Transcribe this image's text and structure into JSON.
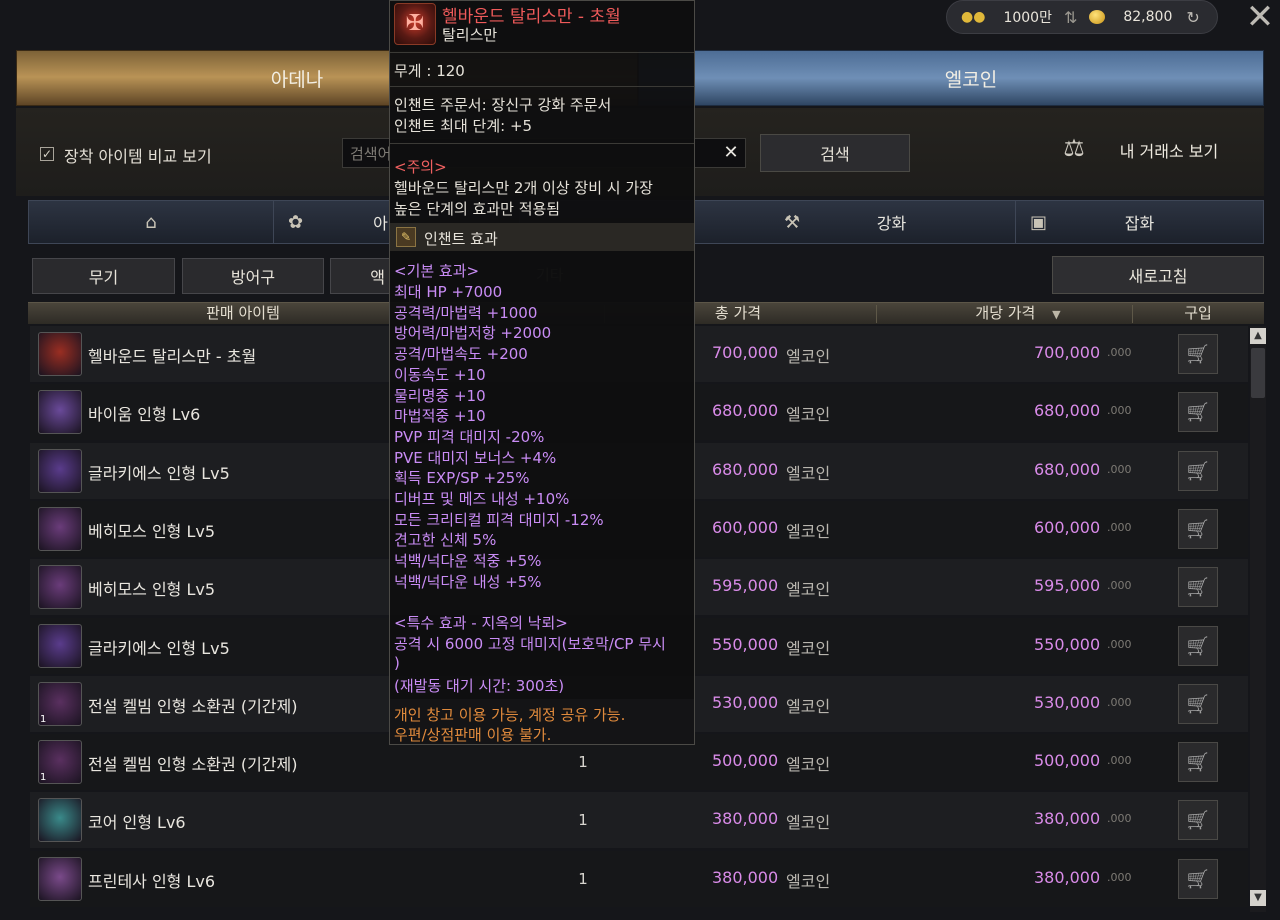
{
  "header": {
    "adena_amount": "1000만",
    "ecoin_amount": "82,800",
    "close_icon": "close-icon",
    "tabs": [
      {
        "label": "아데나"
      },
      {
        "label": "엘코인"
      }
    ]
  },
  "search": {
    "compare_label": "장착 아이템 비교 보기",
    "compare_checked": true,
    "placeholder": "검색어",
    "search_button": "검색",
    "my_exchange": "내 거래소 보기"
  },
  "categories": [
    {
      "label": "",
      "icon": "home-icon"
    },
    {
      "label": "아",
      "icon": "bag-icon"
    },
    {
      "label": "강화",
      "icon": "anvil-icon"
    },
    {
      "label": "잡화",
      "icon": "chest-icon"
    }
  ],
  "filters": [
    "무기",
    "방어구",
    "액",
    "기타"
  ],
  "refresh_button": "새로고침",
  "table": {
    "headers": {
      "item": "판매 아이템",
      "total": "총 가격",
      "unit": "개당 가격",
      "buy": "구입"
    },
    "currency_word": "엘코인",
    "decimal_suffix": ".000",
    "rows": [
      {
        "name": "헬바운드 탈리스만 - 초월",
        "qty": "",
        "total": "700,000",
        "unit": "700,000",
        "icon_color": "#9a2e22",
        "badge": ""
      },
      {
        "name": "바이움 인형 Lv6",
        "qty": "",
        "total": "680,000",
        "unit": "680,000",
        "icon_color": "#6a4a9a",
        "badge": ""
      },
      {
        "name": "글라키에스 인형 Lv5",
        "qty": "",
        "total": "680,000",
        "unit": "680,000",
        "icon_color": "#5a3c8c",
        "badge": ""
      },
      {
        "name": "베히모스 인형 Lv5",
        "qty": "",
        "total": "600,000",
        "unit": "600,000",
        "icon_color": "#6a3c7a",
        "badge": ""
      },
      {
        "name": "베히모스 인형 Lv5",
        "qty": "",
        "total": "595,000",
        "unit": "595,000",
        "icon_color": "#6a3c7a",
        "badge": ""
      },
      {
        "name": "글라키에스 인형 Lv5",
        "qty": "",
        "total": "550,000",
        "unit": "550,000",
        "icon_color": "#5a3c8c",
        "badge": ""
      },
      {
        "name": "전설 켈빔 인형 소환권 (기간제)",
        "qty": "",
        "total": "530,000",
        "unit": "530,000",
        "icon_color": "#5a3060",
        "badge": "1"
      },
      {
        "name": "전설 켈빔 인형 소환권 (기간제)",
        "qty": "1",
        "total": "500,000",
        "unit": "500,000",
        "icon_color": "#5a3060",
        "badge": "1"
      },
      {
        "name": "코어 인형 Lv6",
        "qty": "1",
        "total": "380,000",
        "unit": "380,000",
        "icon_color": "#3a8a8a",
        "badge": ""
      },
      {
        "name": "프린테사 인형 Lv6",
        "qty": "1",
        "total": "380,000",
        "unit": "380,000",
        "icon_color": "#7a4a8a",
        "badge": ""
      }
    ]
  },
  "tooltip": {
    "title": "헬바운드 탈리스만 - 초월",
    "subtitle": "탈리스만",
    "weight": "무게 : 120",
    "enchant_scroll": "인챈트 주문서: 장신구 강화 주문서",
    "enchant_max": "인챈트 최대 단계: +5",
    "caution_header": "<주의>",
    "caution_line1": "헬바운드 탈리스만 2개 이상 장비 시 가장",
    "caution_line2": "높은 단계의 효과만 적용됨",
    "enchant_effect_label": "인챈트 효과",
    "base_header": "<기본 효과>",
    "base_effects": [
      "최대 HP +7000",
      "공격력/마법력 +1000",
      "방어력/마법저항 +2000",
      "공격/마법속도 +200",
      "이동속도 +10",
      "물리명중 +10",
      "마법적중 +10",
      "PVP 피격 대미지 -20%",
      "PVE 대미지 보너스 +4%",
      "획득 EXP/SP +25%",
      "디버프 및 메즈 내성 +10%",
      "모든 크리티컬 피격 대미지 -12%",
      "견고한 신체 5%",
      "넉백/넉다운 적중 +5%",
      "넉백/넉다운 내성 +5%"
    ],
    "special_header": "<특수 효과 - 지옥의 낙뢰>",
    "special_line1": "공격 시 6000 고정 대미지(보호막/CP 무시",
    "special_line2": ")",
    "special_line3": "(재발동 대기 시간: 300초)",
    "footer_line1": "개인 창고 이용 가능, 계정 공유 가능.",
    "footer_line2": "우편/상점판매 이용 불가."
  }
}
